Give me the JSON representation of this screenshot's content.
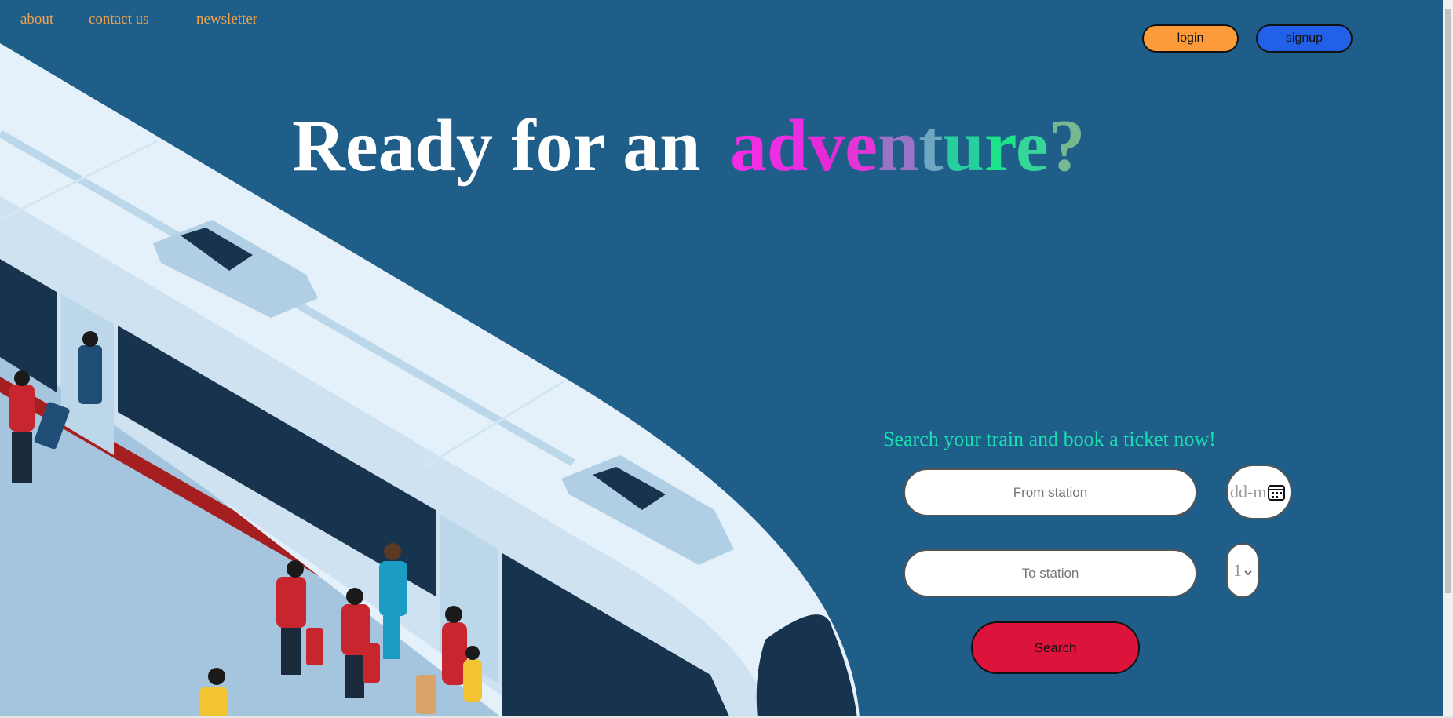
{
  "nav": {
    "about": "about",
    "contact": "contact us",
    "newsletter": "newsletter"
  },
  "auth": {
    "login": "login",
    "signup": "signup"
  },
  "hero": {
    "lead": "Ready for an",
    "highlight_letters": [
      {
        "ch": "a",
        "color": "#f22de4"
      },
      {
        "ch": "d",
        "color": "#ea2ee4"
      },
      {
        "ch": "v",
        "color": "#e62ad8"
      },
      {
        "ch": "e",
        "color": "#e436d6"
      },
      {
        "ch": "n",
        "color": "#9a72c6"
      },
      {
        "ch": "t",
        "color": "#6fa6c0"
      },
      {
        "ch": "u",
        "color": "#27cf9f"
      },
      {
        "ch": "r",
        "color": "#1de38a"
      },
      {
        "ch": "e",
        "color": "#36d59a"
      },
      {
        "ch": "?",
        "color": "#76b890"
      }
    ]
  },
  "search": {
    "heading": "Search your train and book a ticket now!",
    "from_placeholder": "From station",
    "to_placeholder": "To station",
    "date_placeholder": "dd-m",
    "passengers_value": "1",
    "button": "Search"
  },
  "colors": {
    "background": "#1f5e89",
    "login_button": "#fd9a3a",
    "signup_button": "#2260e8",
    "search_button": "#dc143c",
    "heading_accent": "#19e0b1"
  }
}
